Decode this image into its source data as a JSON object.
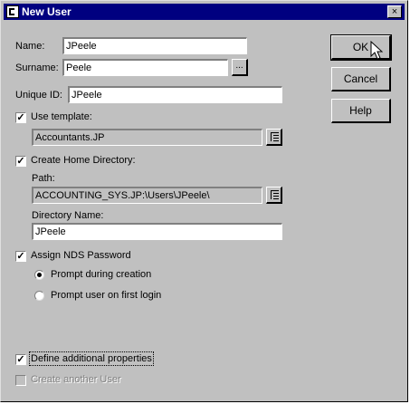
{
  "window": {
    "title": "New User",
    "close_glyph": "×"
  },
  "fields": {
    "name": {
      "label": "Name:",
      "value": "JPeele"
    },
    "surname": {
      "label": "Surname:",
      "value": "Peele",
      "browse": "..."
    },
    "unique_id": {
      "label": "Unique ID:",
      "value": "JPeele"
    }
  },
  "template": {
    "label": "Use template:",
    "checked": true,
    "value": "Accountants.JP"
  },
  "home_dir": {
    "label": "Create Home Directory:",
    "checked": true,
    "path_label": "Path:",
    "path_value": "ACCOUNTING_SYS.JP:\\Users\\JPeele\\",
    "dir_label": "Directory Name:",
    "dir_value": "JPeele"
  },
  "nds": {
    "label": "Assign NDS Password",
    "checked": true,
    "options": [
      "Prompt during creation",
      "Prompt user on first login"
    ],
    "selected": 0
  },
  "define_props": {
    "label": "Define additional properties",
    "checked": true
  },
  "create_another": {
    "label": "Create another User",
    "checked": false,
    "enabled": false
  },
  "buttons": {
    "ok": "OK",
    "cancel": "Cancel",
    "help": "Help"
  },
  "icons": {
    "app": "novell-app-icon",
    "browse": "tree-browse-icon",
    "cursor": "mouse-pointer-icon"
  }
}
